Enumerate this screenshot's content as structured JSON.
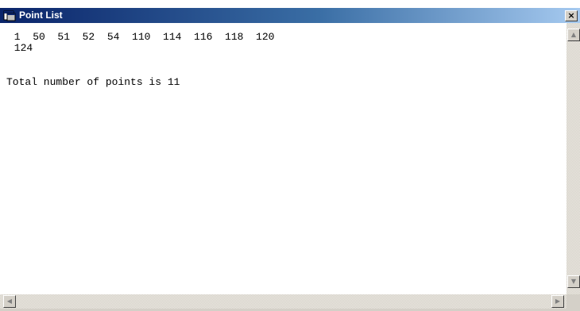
{
  "window": {
    "title": "Point List",
    "close_glyph": "×",
    "icon": "app-window-icon"
  },
  "content": {
    "points_row_1": " 1  50  51  52  54  110  114  116  118  120",
    "points_row_2": " 124",
    "total_line": "Total number of points is 11"
  },
  "scrollbars": {
    "up_arrow": "▲",
    "down_arrow": "▼",
    "left_arrow": "◀",
    "right_arrow": "▶"
  },
  "colors": {
    "titlebar_start": "#0a246a",
    "titlebar_end": "#a6caf0",
    "face": "#d4d0c8"
  }
}
